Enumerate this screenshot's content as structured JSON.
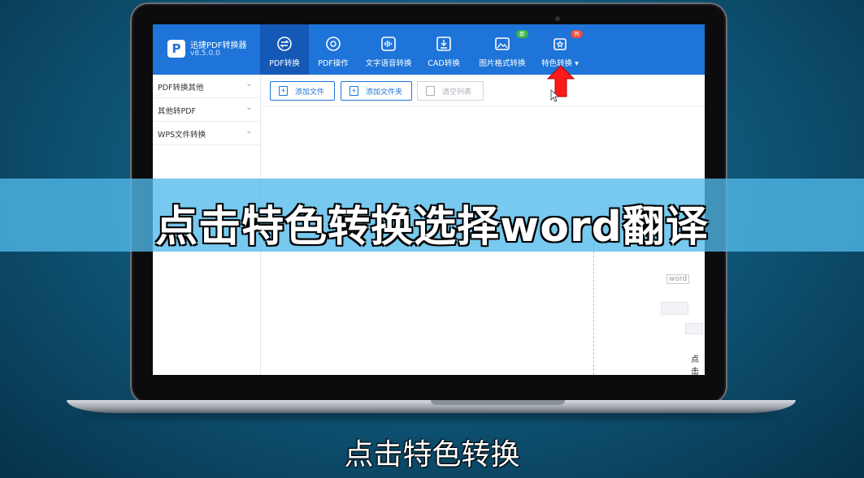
{
  "app": {
    "name": "迅捷PDF转换器",
    "version": "v8.5.0.0",
    "logo_letter": "P",
    "accent_color": "#1e74d8"
  },
  "nav": {
    "tabs": [
      {
        "label": "PDF转换",
        "icon": "convert-icon",
        "active": true
      },
      {
        "label": "PDF操作",
        "icon": "gear-icon"
      },
      {
        "label": "文字语音转换",
        "icon": "audio-wave-icon"
      },
      {
        "label": "CAD转换",
        "icon": "cad-download-icon"
      },
      {
        "label": "图片格式转换",
        "icon": "image-icon",
        "badge": "新"
      },
      {
        "label": "特色转换",
        "icon": "star-box-icon",
        "badge": "热",
        "dropdown_glyph": "▾"
      }
    ]
  },
  "sidebar": {
    "items": [
      {
        "label": "PDF转换其他",
        "chevron": "⌄"
      },
      {
        "label": "其他转PDF",
        "chevron": "⌄"
      },
      {
        "label": "WPS文件转换",
        "chevron": "⌄"
      }
    ]
  },
  "toolbar": {
    "add_file": "添加文件",
    "add_folder": "添加文件夹",
    "clear_list": "清空列表"
  },
  "content": {
    "word_tag": "word",
    "click_fragment": "点击"
  },
  "overlay": {
    "banner": "点击特色转换选择word翻译",
    "subtitle": "点击特色转换"
  }
}
